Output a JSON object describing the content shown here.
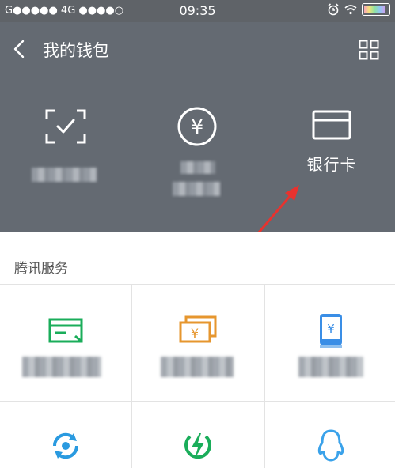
{
  "status_bar": {
    "carrier_left": "G●●●●● 4G ●●●●○",
    "time": "09:35",
    "alarm_icon": "alarm-clock-icon",
    "wifi_icon": "wifi-icon",
    "battery_icon": "battery-icon"
  },
  "header": {
    "back_icon": "chevron-left-icon",
    "title": "我的钱包",
    "menu_icon": "grid-menu-icon",
    "items": [
      {
        "icon": "scan-check-icon",
        "label": ""
      },
      {
        "icon": "yuan-coin-icon",
        "label": ""
      },
      {
        "icon": "bank-card-icon",
        "label": "银行卡"
      }
    ]
  },
  "section": {
    "title": "腾讯服务",
    "tiles": [
      {
        "icon": "card-payment-icon",
        "label": "",
        "color": "#1aad5a"
      },
      {
        "icon": "cash-notes-icon",
        "label": "",
        "color": "#e6962e"
      },
      {
        "icon": "phone-recharge-icon",
        "label": "",
        "color": "#3a8ee6"
      },
      {
        "icon": "refresh-bill-icon",
        "label": "",
        "color": "#2a9ae0"
      },
      {
        "icon": "bolt-icon",
        "label": "",
        "color": "#1aad5a"
      },
      {
        "icon": "qq-penguin-icon",
        "label": "",
        "color": "#3aa2ea"
      }
    ]
  },
  "colors": {
    "header_bg": "#646a72",
    "arrow": "#e8322e"
  }
}
